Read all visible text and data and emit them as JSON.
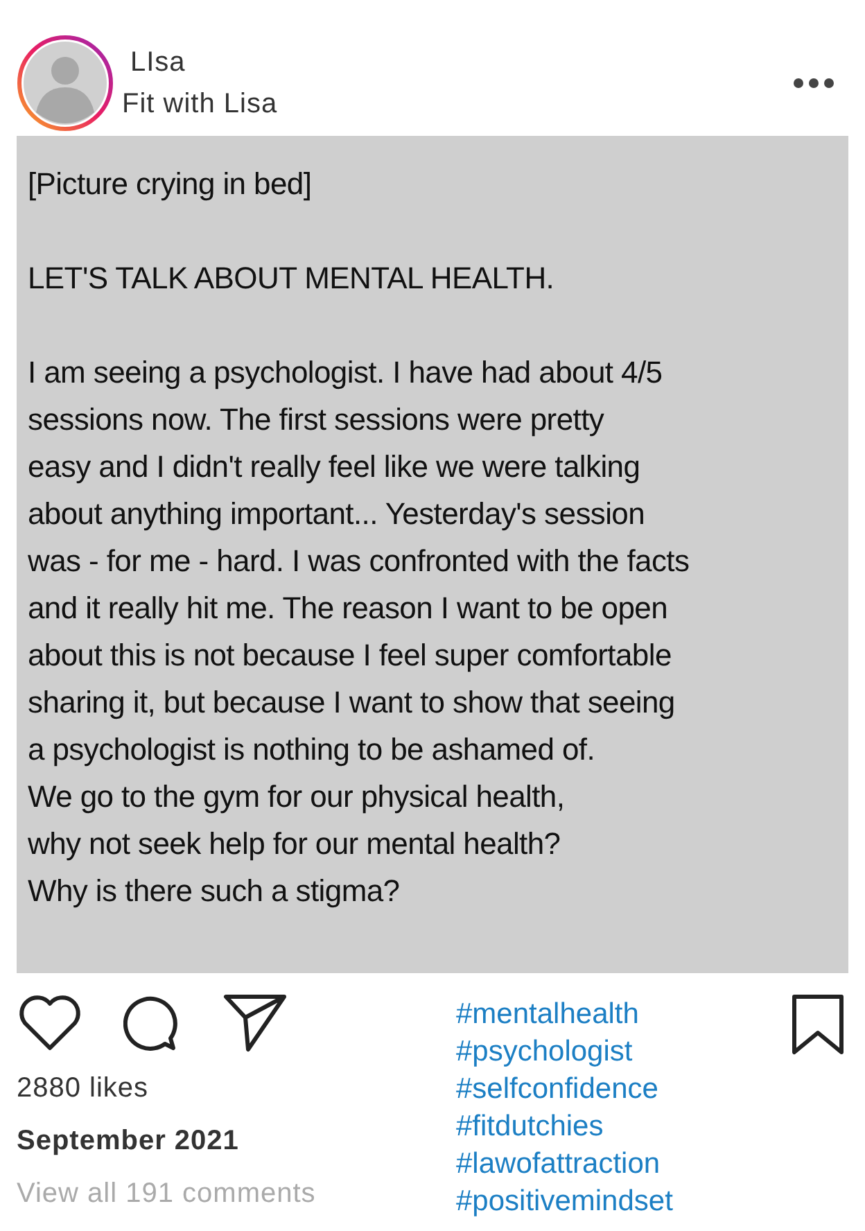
{
  "header": {
    "username": "LIsa",
    "subtitle": "Fit with Lisa"
  },
  "post": {
    "paragraphs": [
      {
        "lines": [
          "[Picture crying in bed]"
        ]
      },
      {
        "lines": [
          "LET'S TALK ABOUT MENTAL HEALTH."
        ]
      },
      {
        "lines": [
          "I am seeing a psychologist. I have had about 4/5",
          "sessions now. The first sessions were pretty",
          "easy and I didn't really feel like we were talking",
          "about anything important... Yesterday's session",
          "was - for me - hard. I was confronted with the facts",
          "and it really hit me. The reason I want to be open",
          "about this is not because I feel super comfortable",
          "sharing it, but because I want to show that seeing",
          "a psychologist is nothing to be ashamed of.",
          "We go to the gym for our physical health,",
          "why not seek help for our mental health?",
          "Why is there such a stigma?"
        ]
      }
    ]
  },
  "footer": {
    "likes": "2880 likes",
    "date": "September 2021",
    "comments": "View all 191 comments",
    "hashtags": [
      "#mentalhealth",
      "#psychologist",
      "#selfconfidence",
      "#fitdutchies",
      "#lawofattraction",
      "#positivemindset"
    ]
  }
}
